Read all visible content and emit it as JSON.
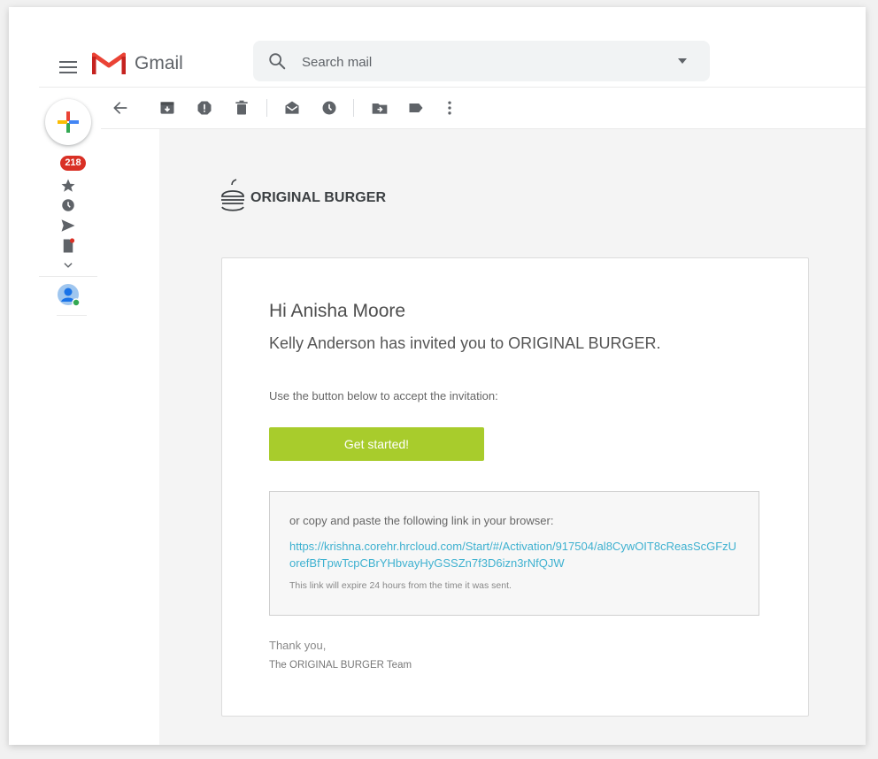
{
  "app": {
    "logo_text": "Gmail"
  },
  "search": {
    "placeholder": "Search mail"
  },
  "sidebar": {
    "inbox_count": "218"
  },
  "icons": {
    "menu": "hamburger-menu-icon",
    "back": "arrow-back-icon",
    "archive": "archive-icon",
    "spam": "report-spam-icon",
    "delete": "trash-icon",
    "mark_unread": "mark-unread-icon",
    "snooze": "snooze-clock-icon",
    "move": "move-to-folder-icon",
    "label": "label-icon",
    "more": "more-vert-icon"
  },
  "email": {
    "brand_name": "ORIGINAL BURGER",
    "greeting": "Hi Anisha Moore",
    "invite_line": "Kelly Anderson has invited you to ORIGINAL BURGER.",
    "instruction": "Use the button below to accept the invitation:",
    "cta_label": "Get started!",
    "copy_text": "or copy and paste the following link in your browser:",
    "link_url": "https://krishna.corehr.hrcloud.com/Start/#/Activation/917504/al8CywOIT8cReasScGFzUorefBfTpwTcpCBrYHbvayHyGSSZn7f3D6izn3rNfQJW",
    "expire_note": "This link will expire 24 hours from the time it was sent.",
    "thanks": "Thank you,",
    "team": "The ORIGINAL BURGER Team"
  },
  "colors": {
    "cta": "#a8cc2c",
    "link": "#3eb1d0",
    "badge": "#d93025",
    "gmail_red": "#ea4335"
  }
}
